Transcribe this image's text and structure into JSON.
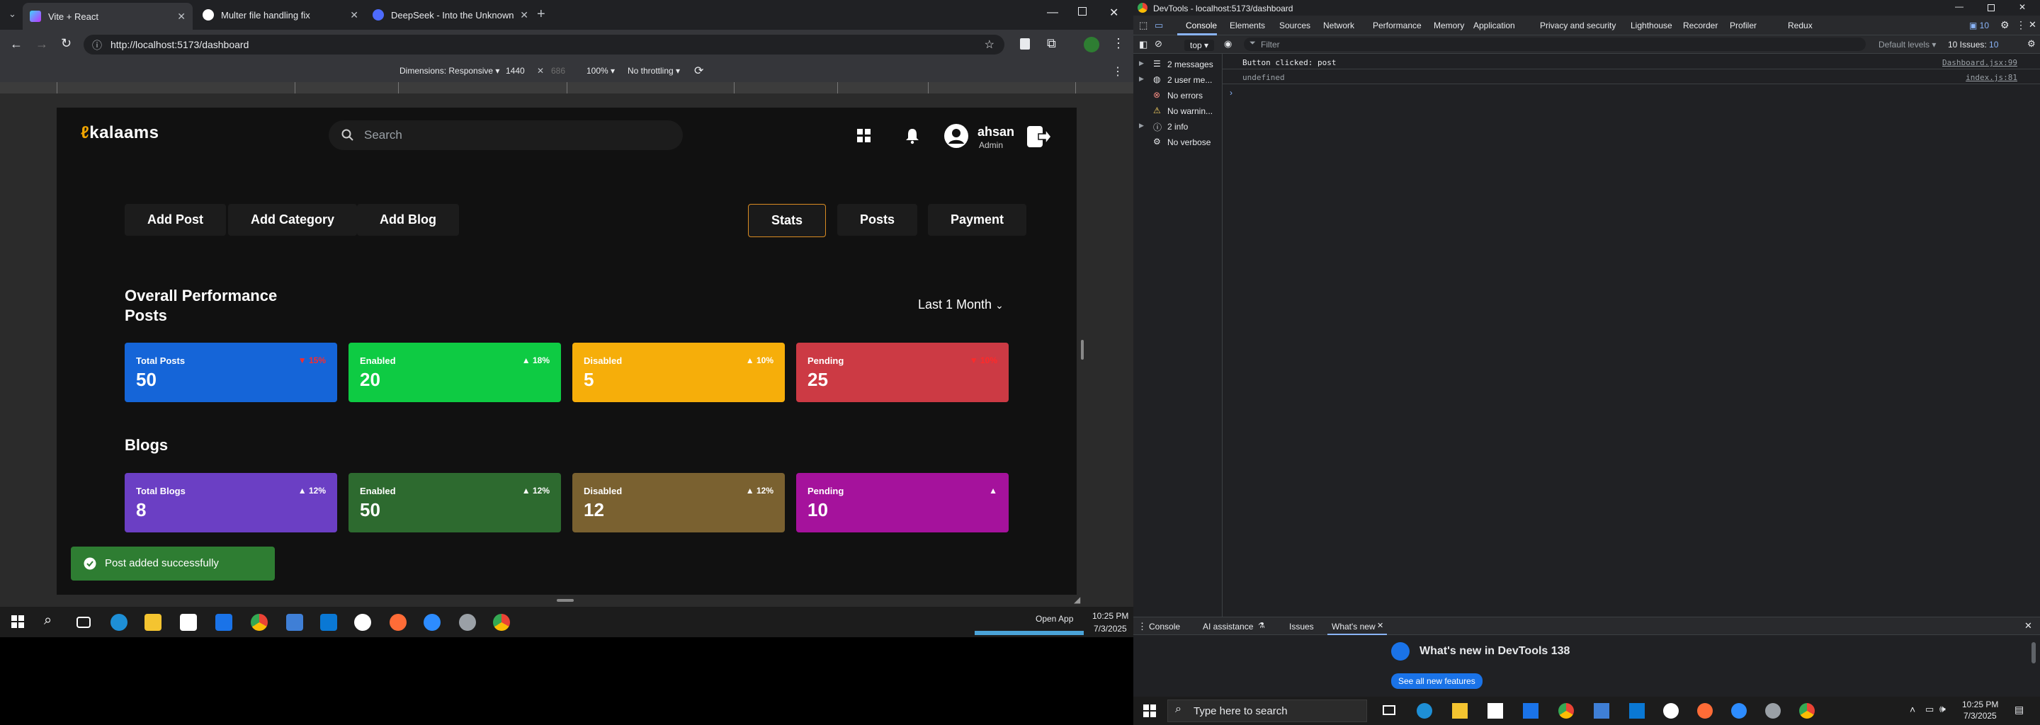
{
  "browser": {
    "tabs": [
      {
        "label": "Vite + React",
        "favicon_color": "#9b5cff"
      },
      {
        "label": "Multer file handling fix",
        "favicon_color": "#ffffff"
      },
      {
        "label": "DeepSeek - Into the Unknown",
        "favicon_color": "#4d6bfe"
      }
    ],
    "url": "http://localhost:5173/dashboard",
    "devicebar": {
      "dimensions": "Dimensions: Responsive",
      "width": "1440",
      "height": "686",
      "zoom": "100%",
      "throttling": "No throttling"
    }
  },
  "app": {
    "logo_text": "kalaams",
    "search_placeholder": "Search",
    "user_name": "ahsan",
    "user_role": "Admin",
    "actions": [
      "Add Post",
      "Add Category",
      "Add Blog"
    ],
    "views": [
      "Stats",
      "Posts",
      "Payment"
    ],
    "section_posts": "Overall Performance Posts",
    "section_posts_line1": "Overall Performance",
    "section_posts_line2": "Posts",
    "period": "Last 1 Month",
    "post_cards": [
      {
        "label": "Total Posts",
        "value": "50",
        "pct": "15%",
        "trend": "down",
        "color": "#1565d8",
        "pct_color": "#ff2a2a"
      },
      {
        "label": "Enabled",
        "value": "20",
        "pct": "18%",
        "trend": "up",
        "color": "#0ecb43",
        "pct_color": "#ffffff"
      },
      {
        "label": "Disabled",
        "value": "5",
        "pct": "10%",
        "trend": "up",
        "color": "#f6ae0a",
        "pct_color": "#ffffff"
      },
      {
        "label": "Pending",
        "value": "25",
        "pct": "10%",
        "trend": "down",
        "color": "#cc3a44",
        "pct_color": "#ff2a2a"
      }
    ],
    "section_blogs": "Blogs",
    "blog_cards": [
      {
        "label": "Total Blogs",
        "value": "8",
        "pct": "12%",
        "trend": "up",
        "color": "#6b3fc4",
        "pct_color": "#ffffff"
      },
      {
        "label": "Enabled",
        "value": "50",
        "pct": "12%",
        "trend": "up",
        "color": "#2d6a2f",
        "pct_color": "#ffffff"
      },
      {
        "label": "Disabled",
        "value": "12",
        "pct": "12%",
        "trend": "up",
        "color": "#7a6130",
        "pct_color": "#ffffff"
      },
      {
        "label": "Pending",
        "value": "10",
        "pct": "",
        "trend": "up",
        "color": "#a5129c",
        "pct_color": "#ffffff"
      }
    ],
    "toast": "Post added successfully"
  },
  "taskbar_left": {
    "open_app": "Open App",
    "time": "10:25 PM",
    "date": "7/3/2025"
  },
  "devtools": {
    "title": "DevTools - localhost:5173/dashboard",
    "tabs": [
      "Console",
      "Elements",
      "Sources",
      "Network",
      "Performance",
      "Memory",
      "Application",
      "Privacy and security",
      "Lighthouse",
      "Recorder",
      "Profiler",
      "Redux"
    ],
    "issues_badge": "10",
    "context": "top",
    "filter_placeholder": "Filter",
    "levels": "Default levels",
    "issues_count": "10 Issues:",
    "issues_num": "10",
    "sidebar": [
      {
        "label": "2 messages",
        "icon": "list-icon"
      },
      {
        "label": "2 user me...",
        "icon": "user-icon"
      },
      {
        "label": "No errors",
        "icon": "error-icon"
      },
      {
        "label": "No warnin...",
        "icon": "warning-icon"
      },
      {
        "label": "2 info",
        "icon": "info-icon"
      },
      {
        "label": "No verbose",
        "icon": "verbose-icon"
      }
    ],
    "logs": [
      {
        "text": "Button clicked: post",
        "source": "Dashboard.jsx:99"
      },
      {
        "text": "undefined",
        "source": "index.js:81"
      }
    ],
    "drawer_tabs": [
      "Console",
      "AI assistance",
      "Issues",
      "What's new"
    ],
    "whats_new_title": "What's new in DevTools 138",
    "whats_new_button": "See all new features"
  },
  "taskbar_right": {
    "search_placeholder": "Type here to search",
    "time": "10:25 PM",
    "date": "7/3/2025"
  }
}
